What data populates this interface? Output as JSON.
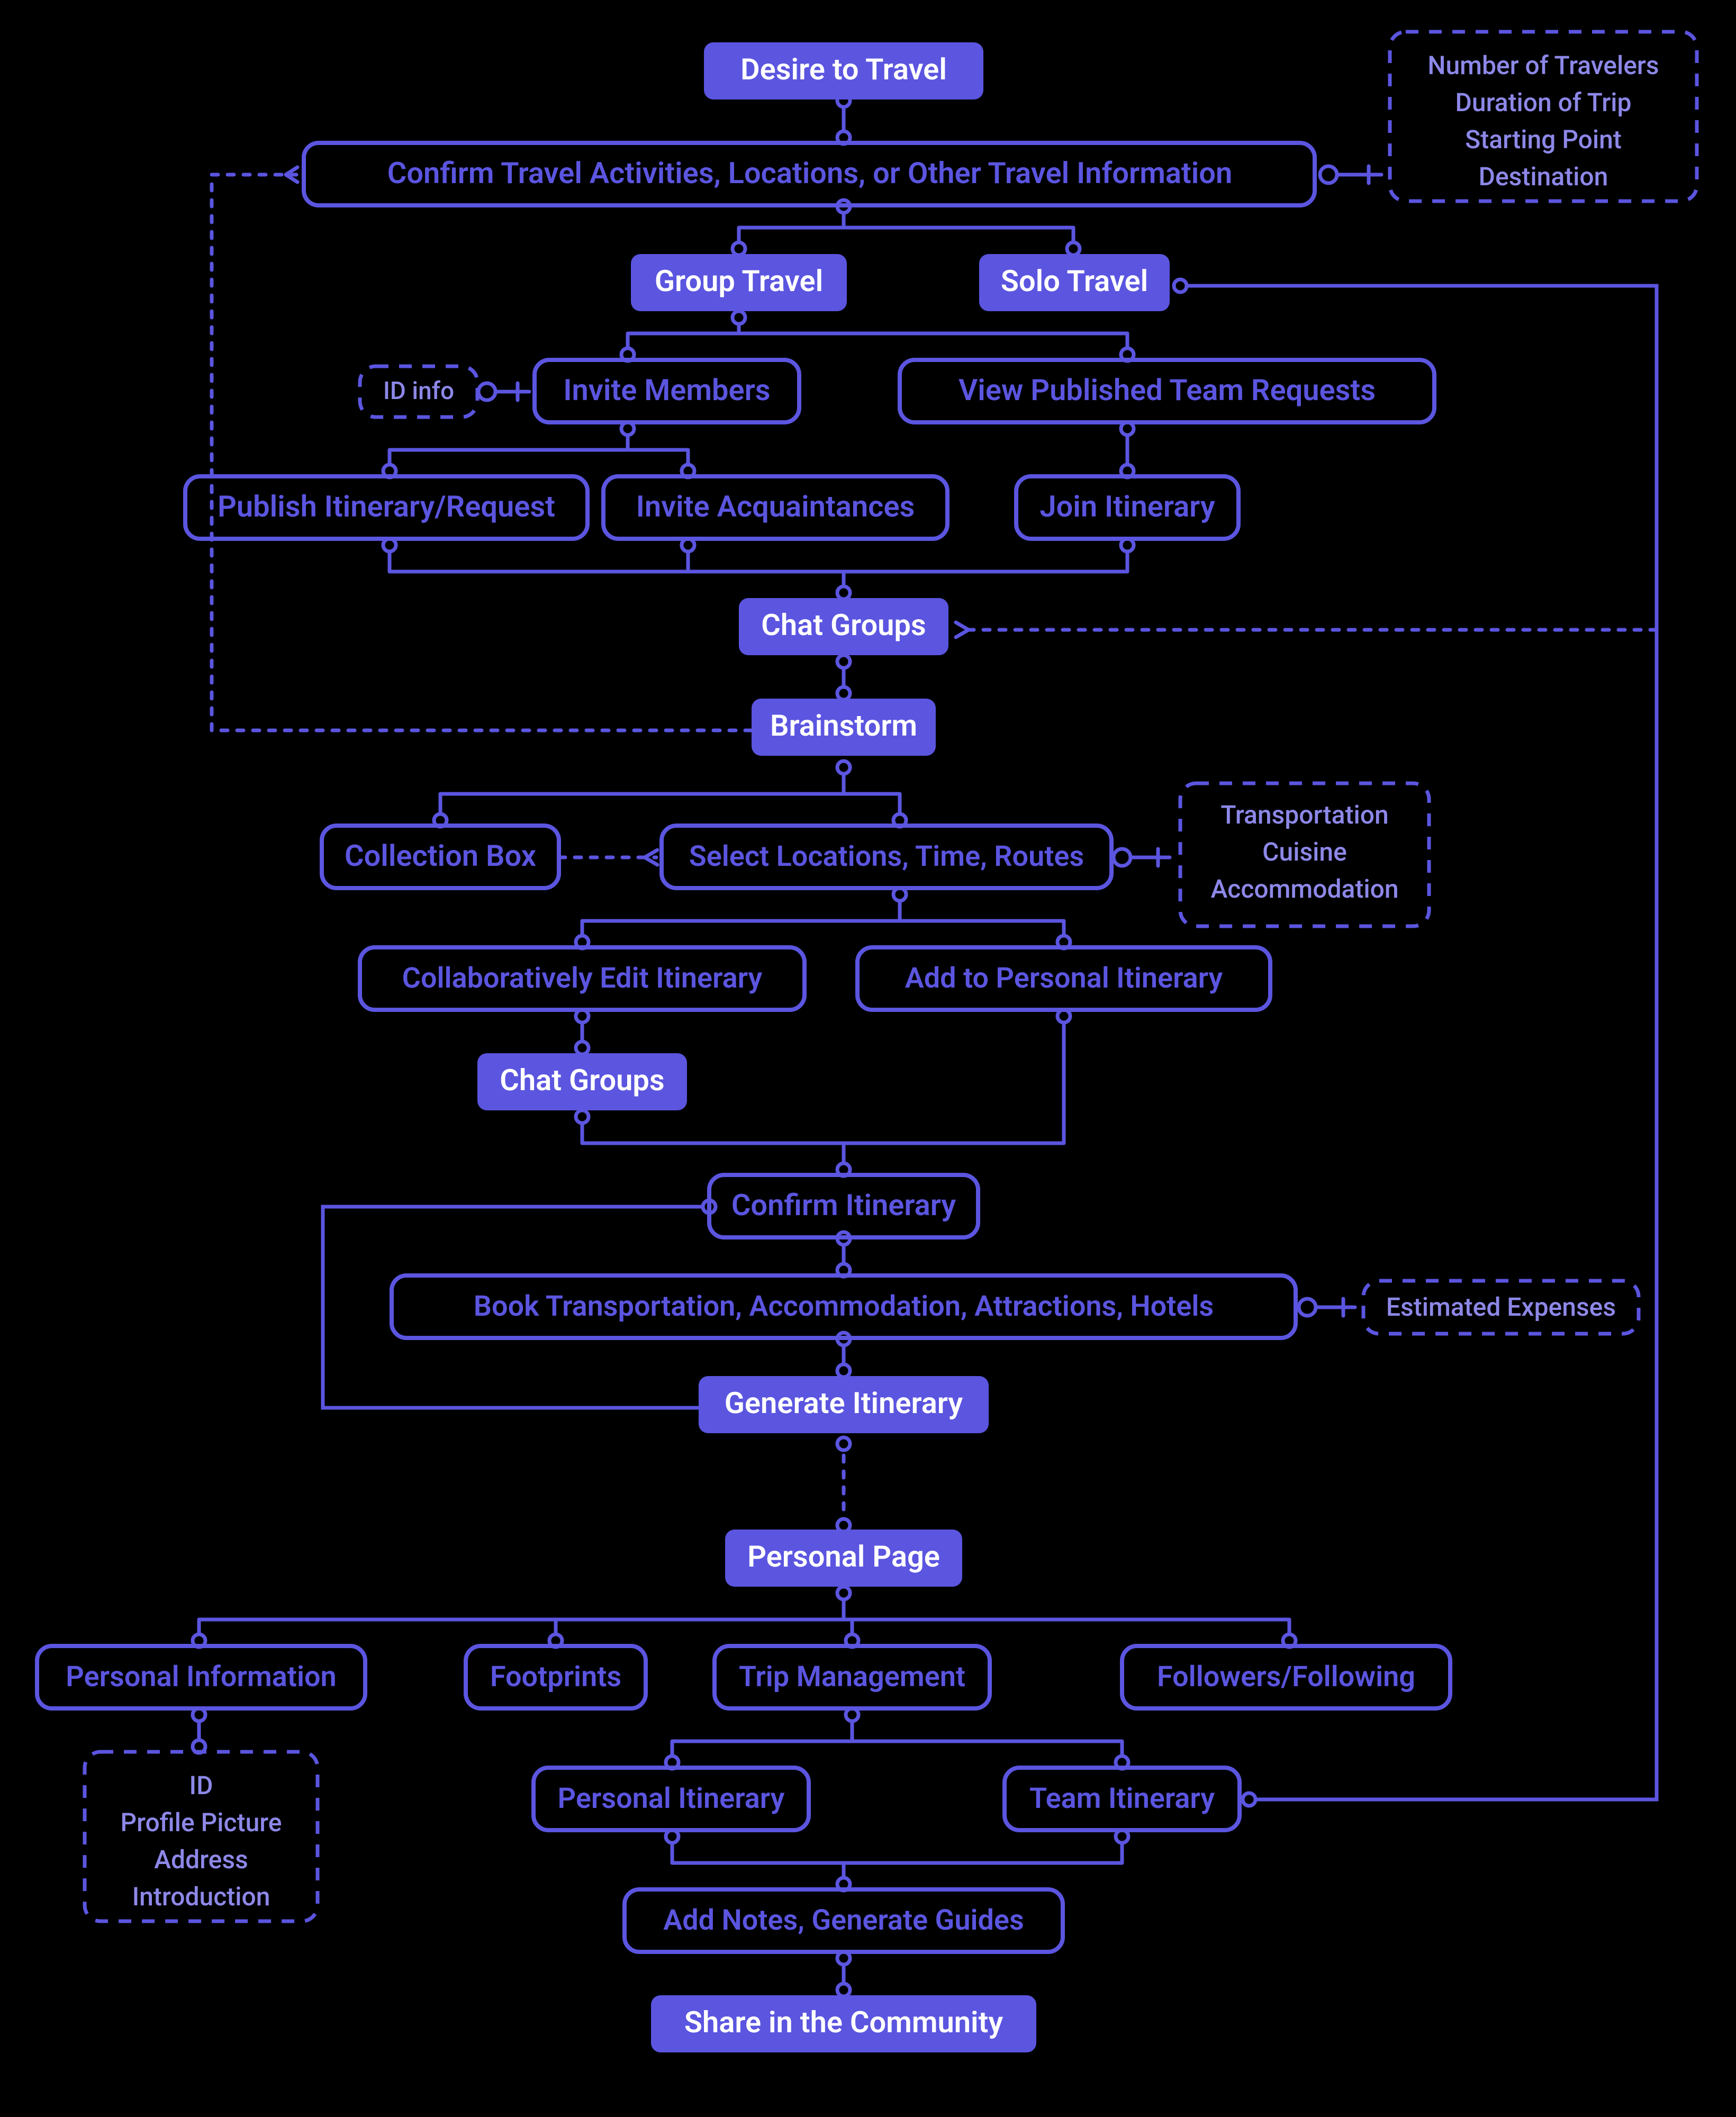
{
  "colors": {
    "accent": "#5b55e0",
    "bg": "#000000",
    "annotText": "#8d88e8"
  },
  "nodes": {
    "desire": {
      "label": "Desire to Travel"
    },
    "confirm_info": {
      "label": "Confirm Travel Activities, Locations, or Other Travel Information"
    },
    "group_travel": {
      "label": "Group Travel"
    },
    "solo_travel": {
      "label": "Solo Travel"
    },
    "invite_members": {
      "label": "Invite Members"
    },
    "view_team_req": {
      "label": "View Published Team Requests"
    },
    "publish_req": {
      "label": "Publish Itinerary/Request"
    },
    "invite_acq": {
      "label": "Invite Acquaintances"
    },
    "join_itin": {
      "label": "Join Itinerary"
    },
    "chat_groups": {
      "label": "Chat Groups"
    },
    "brainstorm": {
      "label": "Brainstorm"
    },
    "collection_box": {
      "label": "Collection Box"
    },
    "select_loc": {
      "label": "Select Locations, Time, Routes"
    },
    "collab_edit": {
      "label": "Collaboratively Edit Itinerary"
    },
    "add_personal": {
      "label": "Add to Personal Itinerary"
    },
    "chat_groups2": {
      "label": "Chat Groups"
    },
    "confirm_itin": {
      "label": "Confirm Itinerary"
    },
    "book": {
      "label": "Book Transportation, Accommodation, Attractions, Hotels"
    },
    "generate_itin": {
      "label": "Generate Itinerary"
    },
    "personal_page": {
      "label": "Personal Page"
    },
    "personal_info": {
      "label": "Personal Information"
    },
    "footprints": {
      "label": "Footprints"
    },
    "trip_mgmt": {
      "label": "Trip Management"
    },
    "followers": {
      "label": "Followers/Following"
    },
    "personal_itin": {
      "label": "Personal Itinerary"
    },
    "team_itin": {
      "label": "Team Itinerary"
    },
    "add_notes": {
      "label": "Add Notes, Generate Guides"
    },
    "share": {
      "label": "Share in the Community"
    }
  },
  "annotations": {
    "travel_params": {
      "lines": [
        "Number of Travelers",
        "Duration of Trip",
        "Starting Point",
        "Destination"
      ]
    },
    "id_info": {
      "lines": [
        "ID info"
      ]
    },
    "brainstorm_cat": {
      "lines": [
        "Transportation",
        "Cuisine",
        "Accommodation"
      ]
    },
    "est_expenses": {
      "lines": [
        "Estimated Expenses"
      ]
    },
    "personal_detail": {
      "lines": [
        "ID",
        "Profile Picture",
        "Address",
        "Introduction"
      ]
    }
  }
}
